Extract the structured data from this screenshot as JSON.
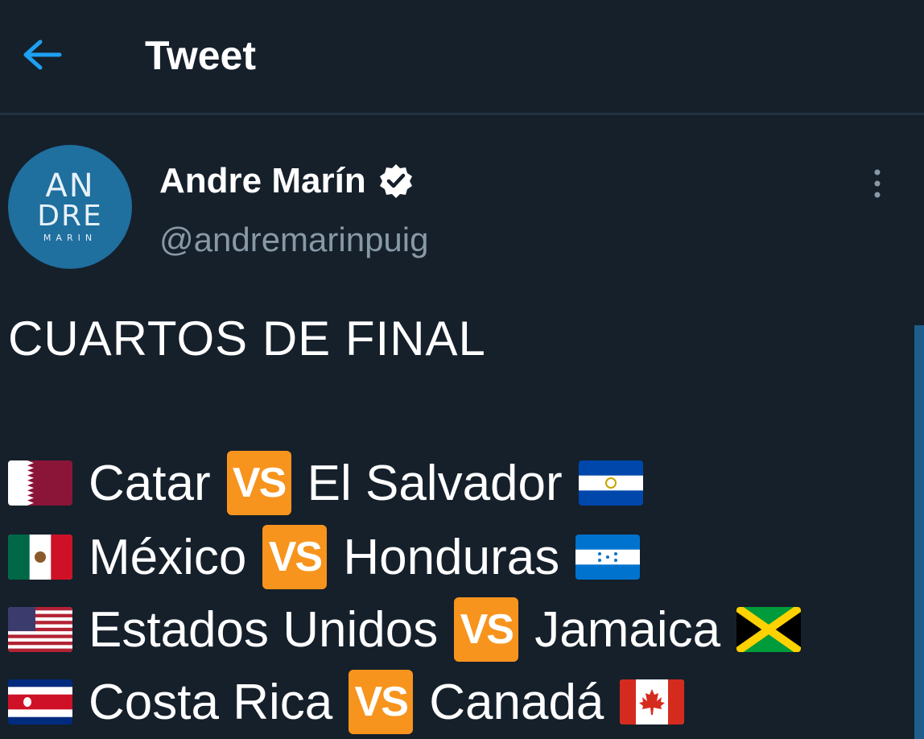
{
  "header": {
    "title": "Tweet",
    "back_icon": "arrow-left-icon"
  },
  "author": {
    "name": "Andre Marín",
    "handle": "@andremarinpuig",
    "verified": true,
    "avatar_logo": [
      "AN",
      "DRE",
      "MARIN"
    ]
  },
  "tweet": {
    "title": "CUARTOS DE FINAL",
    "vs_label": "VS",
    "matches": [
      {
        "home": "Catar",
        "home_flag": "qatar-flag-icon",
        "away": "El Salvador",
        "away_flag": "el-salvador-flag-icon"
      },
      {
        "home": "México",
        "home_flag": "mexico-flag-icon",
        "away": "Honduras",
        "away_flag": "honduras-flag-icon"
      },
      {
        "home": "Estados Unidos",
        "home_flag": "usa-flag-icon",
        "away": "Jamaica",
        "away_flag": "jamaica-flag-icon"
      },
      {
        "home": "Costa Rica",
        "home_flag": "costa-rica-flag-icon",
        "away": "Canadá",
        "away_flag": "canada-flag-icon"
      }
    ]
  },
  "colors": {
    "background": "#15202b",
    "accent": "#1da1f2",
    "secondary_text": "#8899a6",
    "vs_badge": "#f7941d"
  }
}
